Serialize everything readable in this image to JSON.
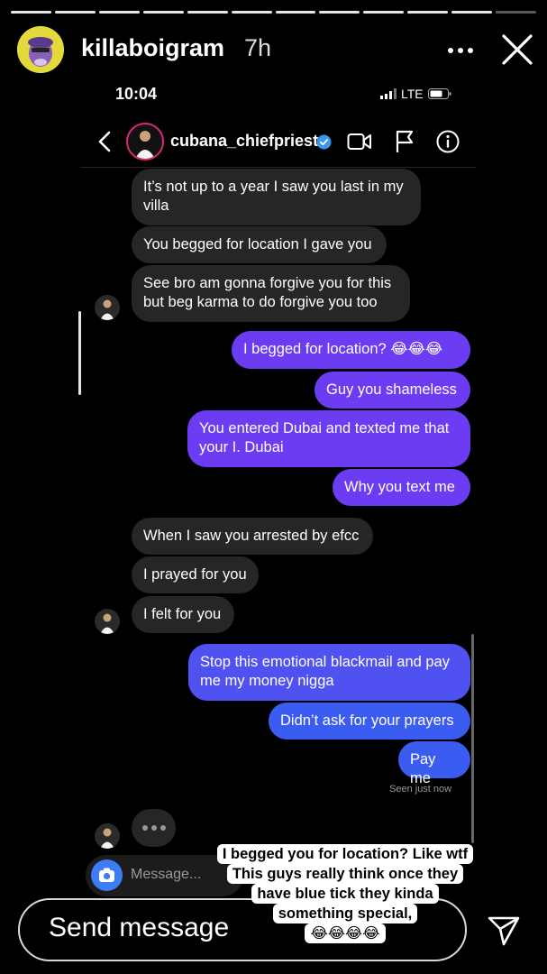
{
  "story": {
    "username": "killaboigram",
    "time_ago": "7h",
    "progress_total": 12,
    "progress_done": 11
  },
  "status_bar": {
    "time": "10:04",
    "network": "LTE"
  },
  "chat": {
    "username": "cubana_chiefpriest",
    "verified": true
  },
  "messages": [
    {
      "side": "in",
      "text": "It’s not up to a year I saw you last in my villa"
    },
    {
      "side": "in",
      "text": "You begged for location I gave you"
    },
    {
      "side": "in",
      "text": "See bro am gonna forgive you for this but beg karma to do forgive you too"
    },
    {
      "side": "out",
      "text": "I begged for location? 😂😂😂"
    },
    {
      "side": "out",
      "text": "Guy you shameless"
    },
    {
      "side": "out",
      "text": "You entered Dubai and texted me that your I. Dubai"
    },
    {
      "side": "out",
      "text": "Why you text me"
    },
    {
      "side": "in",
      "text": "When I saw you arrested by efcc"
    },
    {
      "side": "in",
      "text": "I prayed for you"
    },
    {
      "side": "in",
      "text": "I felt for you"
    },
    {
      "side": "out",
      "text": "Stop this emotional blackmail and pay me my money nigga"
    },
    {
      "side": "out",
      "text": "Didn’t ask for your prayers"
    },
    {
      "side": "out",
      "text": "Pay me"
    }
  ],
  "seen_label": "Seen just now",
  "composer": {
    "placeholder": "Message..."
  },
  "reply_bar": {
    "placeholder": "Send message"
  },
  "caption": {
    "lines": [
      "I begged you for location? Like wtf",
      "This guys really think once they",
      "have blue tick they kinda",
      "something special,",
      "😂😂😂😂"
    ]
  },
  "colors": {
    "outgoing_purple": "#6c3cf2",
    "outgoing_blue": "#3b5cf0",
    "incoming_gray": "#262626",
    "verified_blue": "#3897f0",
    "story_avatar_bg": "#e3d93a"
  }
}
